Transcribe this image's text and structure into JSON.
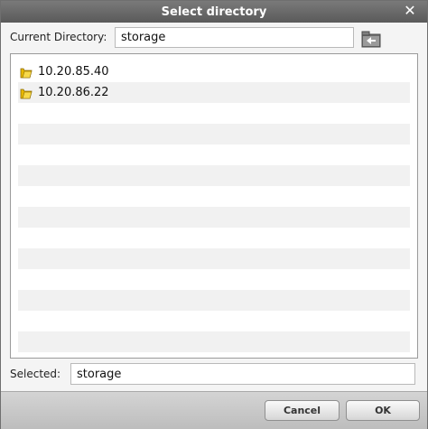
{
  "dialog": {
    "title": "Select directory",
    "current_directory_label": "Current Directory:",
    "current_directory_value": "storage",
    "selected_label": "Selected:",
    "selected_value": "storage",
    "cancel_label": "Cancel",
    "ok_label": "OK"
  },
  "entries": [
    {
      "name": "10.20.85.40",
      "icon": "folder-icon"
    },
    {
      "name": "10.20.86.22",
      "icon": "folder-icon"
    }
  ],
  "colors": {
    "titlebar": "#666666",
    "folder": "#e8b800"
  }
}
